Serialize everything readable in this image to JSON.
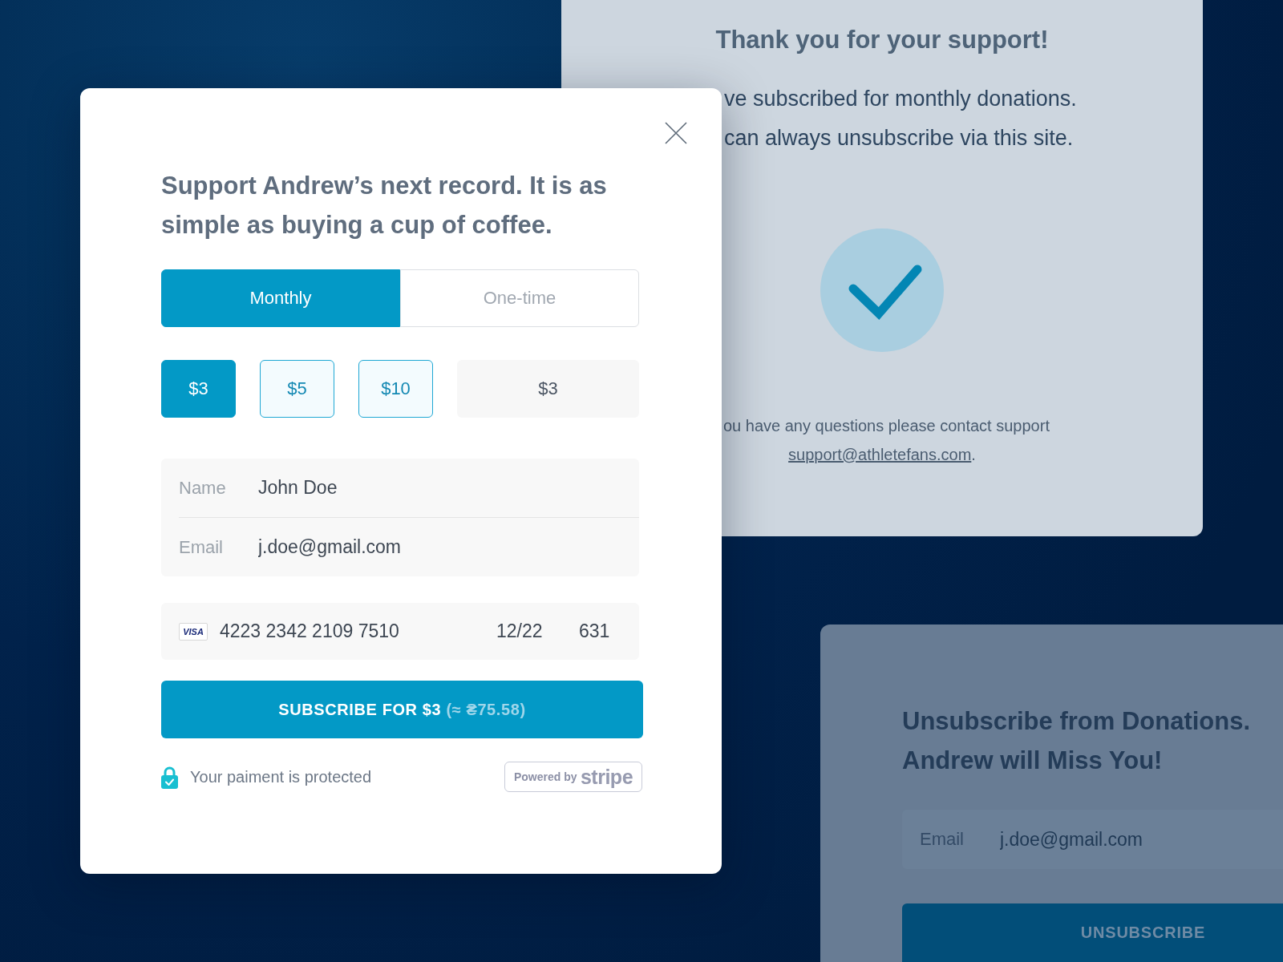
{
  "thank_you_card": {
    "title": "Thank you for your support!",
    "lines": [
      "ve subscribed for monthly donations.",
      "can always unsubscribe via this site."
    ],
    "note": "ou have any questions please contact support",
    "support_link": "support@athletefans.com",
    "link_suffix": "."
  },
  "donation_modal": {
    "heading": "Support Andrew’s next record. It is as simple as buying a cup of coffee.",
    "frequency_tabs": [
      {
        "label": "Monthly",
        "selected": true
      },
      {
        "label": "One-time",
        "selected": false
      }
    ],
    "amounts": [
      {
        "label": "$3",
        "selected": true
      },
      {
        "label": "$5",
        "selected": false
      },
      {
        "label": "$10",
        "selected": false
      }
    ],
    "custom_amount": {
      "value": "$3"
    },
    "fields": [
      {
        "label": "Name",
        "value": "John Doe"
      },
      {
        "label": "Email",
        "value": "j.doe@gmail.com"
      }
    ],
    "card": {
      "brand": "VISA",
      "number": "4223 2342 2109 7510",
      "expiry": "12/22",
      "cvc": "631"
    },
    "subscribe_button": {
      "label": "SUBSCRIBE FOR $3",
      "converted": "(≈ ₴75.58)"
    },
    "security_note": "Your paiment is protected",
    "powered_by": {
      "prefix": "Powered by",
      "brand": "stripe"
    }
  },
  "unsubscribe_card": {
    "heading": "Unsubscribe from Donations. Andrew will Miss You!",
    "email_field": {
      "label": "Email",
      "value": "j.doe@gmail.com"
    },
    "button": "UNSUBSCRIBE"
  }
}
